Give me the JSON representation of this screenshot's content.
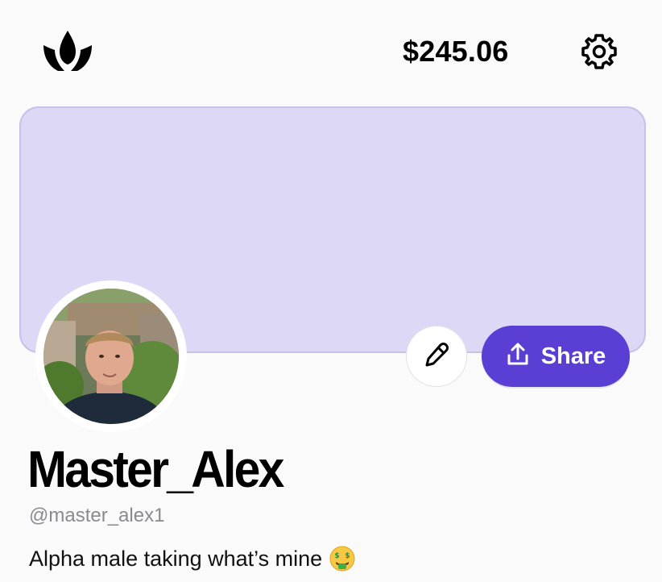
{
  "header": {
    "logo_icon": "crown-icon",
    "balance": "$245.06",
    "settings_icon": "gear-icon"
  },
  "banner": {
    "color": "#dcd8f6"
  },
  "profile": {
    "avatar_icon": "avatar",
    "display_name": "Master_Alex",
    "handle": "@master_alex1",
    "bio": "Alpha male taking what’s mine",
    "bio_emoji": "money-mouth-face-icon"
  },
  "actions": {
    "edit_icon": "pencil-icon",
    "share_icon": "upload-icon",
    "share_label": "Share",
    "accent_color": "#5b3ed3"
  }
}
